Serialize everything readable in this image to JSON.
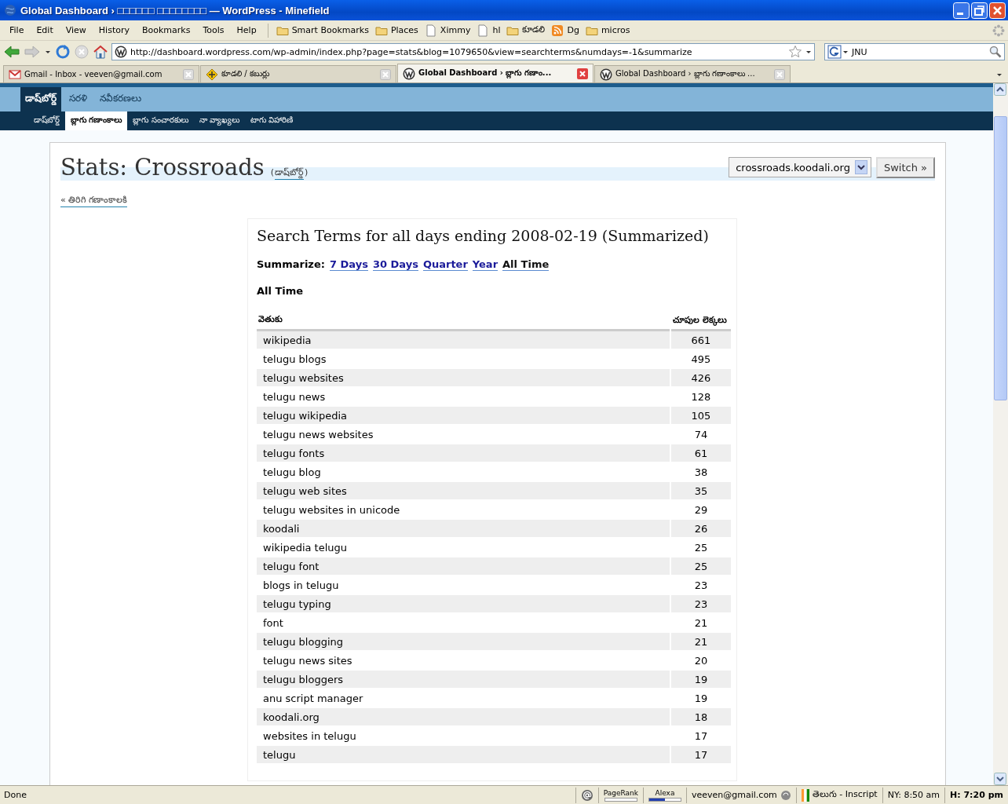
{
  "window": {
    "title": "Global Dashboard › □□□□□□ □□□□□□□□ — WordPress - Minefield"
  },
  "menu": [
    "File",
    "Edit",
    "View",
    "History",
    "Bookmarks",
    "Tools",
    "Help"
  ],
  "bookmarks": [
    {
      "label": "Smart Bookmarks",
      "kind": "folder"
    },
    {
      "label": "Places",
      "kind": "folder"
    },
    {
      "label": "Ximmy",
      "kind": "page"
    },
    {
      "label": "hl",
      "kind": "page"
    },
    {
      "label": "కూడలి",
      "kind": "folder"
    },
    {
      "label": "Dg",
      "kind": "feed"
    },
    {
      "label": "micros",
      "kind": "folder"
    }
  ],
  "address": "http://dashboard.wordpress.com/wp-admin/index.php?page=stats&blog=1079650&view=searchterms&numdays=-1&summarize",
  "search": {
    "value": "JNU"
  },
  "tabs": [
    {
      "label": "Gmail - Inbox - veeven@gmail.com",
      "kind": "mail",
      "selected": false
    },
    {
      "label": "కూడలి / కబుర్లు",
      "kind": "site",
      "selected": false
    },
    {
      "label": "Global Dashboard › బ్లాగు గణాం...",
      "kind": "wp",
      "selected": true
    },
    {
      "label": "Global Dashboard › బ్లాగు గణాంకాలు ...",
      "kind": "wp",
      "selected": false
    }
  ],
  "top_nav": [
    {
      "label": "డాష్‌బోర్డ్",
      "selected": true
    },
    {
      "label": "సరళి",
      "selected": false
    },
    {
      "label": "నవీకరణలు",
      "selected": false
    }
  ],
  "sub_nav": [
    {
      "label": "డాష్‌బోర్డ్",
      "selected": false
    },
    {
      "label": "బ్లాగు గణాంకాలు",
      "selected": true
    },
    {
      "label": "బ్లాగు సంచారకులు",
      "selected": false
    },
    {
      "label": "నా వ్యాఖ్యలు",
      "selected": false
    },
    {
      "label": "టాగు విహారిణి",
      "selected": false
    }
  ],
  "page": {
    "title": "Stats: Crossroads",
    "paren_open": "(",
    "dashboard_link": "డాష్‌బోర్డ్",
    "paren_close": ")",
    "back_link": "« తిరిగి గణాంకాలకి",
    "blog_select": "crossroads.koodali.org",
    "switch_button": "Switch »"
  },
  "report": {
    "heading": "Search Terms for all days ending 2008-02-19 (Summarized)",
    "summarize_label": "Summarize:",
    "periods": [
      {
        "label": "7 Days",
        "selected": false
      },
      {
        "label": "30 Days",
        "selected": false
      },
      {
        "label": "Quarter",
        "selected": false
      },
      {
        "label": "Year",
        "selected": false
      },
      {
        "label": "All Time",
        "selected": true
      }
    ],
    "section": "All Time",
    "columns": [
      "వెతుకు",
      "చూపుల లెక్కలు"
    ],
    "rows": [
      [
        "wikipedia",
        "661"
      ],
      [
        "telugu blogs",
        "495"
      ],
      [
        "telugu websites",
        "426"
      ],
      [
        "telugu news",
        "128"
      ],
      [
        "telugu wikipedia",
        "105"
      ],
      [
        "telugu news websites",
        "74"
      ],
      [
        "telugu fonts",
        "61"
      ],
      [
        "telugu blog",
        "38"
      ],
      [
        "telugu web sites",
        "35"
      ],
      [
        "telugu websites in unicode",
        "29"
      ],
      [
        "koodali",
        "26"
      ],
      [
        "wikipedia telugu",
        "25"
      ],
      [
        "telugu font",
        "25"
      ],
      [
        "blogs in telugu",
        "23"
      ],
      [
        "telugu typing",
        "23"
      ],
      [
        "font",
        "21"
      ],
      [
        "telugu blogging",
        "21"
      ],
      [
        "telugu news sites",
        "20"
      ],
      [
        "telugu bloggers",
        "19"
      ],
      [
        "anu script manager",
        "19"
      ],
      [
        "koodali.org",
        "18"
      ],
      [
        "websites in telugu",
        "17"
      ],
      [
        "telugu",
        "17"
      ]
    ]
  },
  "status_bar": {
    "text": "Done",
    "pagerank": "PageRank",
    "alexa": "Alexa",
    "account": "veeven@gmail.com",
    "keyboard": "తెలుగు - Inscript",
    "time_ny": "NY: 8:50 am",
    "time_h": "H: 7:20 pm"
  }
}
